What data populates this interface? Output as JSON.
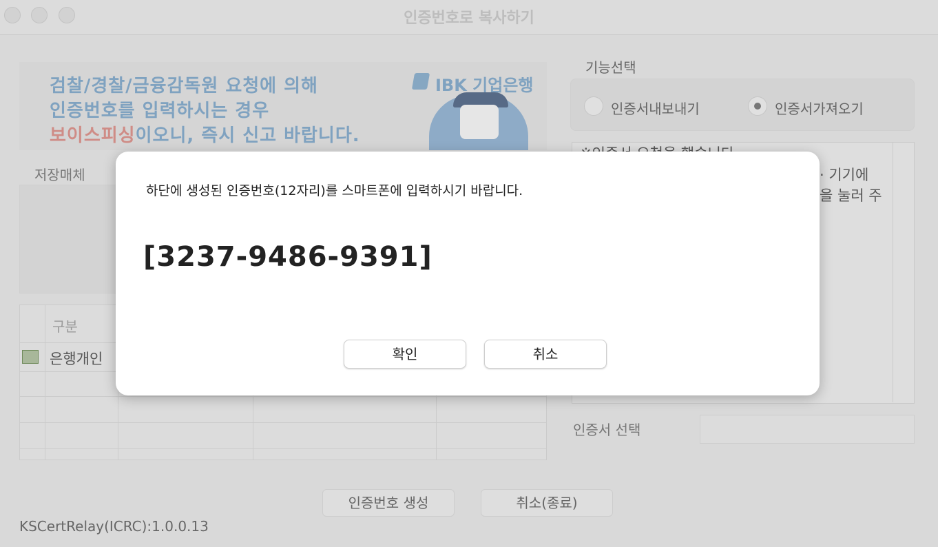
{
  "window": {
    "title": "인증번호로 복사하기"
  },
  "banner": {
    "line1": "검찰/경찰/금융감독원 요청에 의해",
    "line2": "인증번호를 입력하시는 경우",
    "line3_red": "보이스피싱",
    "line3_rest": "이오니, 즉시 신고 바랍니다.",
    "brand": "IBK 기업은행"
  },
  "left": {
    "storage_label": "저장매체",
    "table_header": "구분",
    "row1_label": "은행개인"
  },
  "right": {
    "function_label": "기능선택",
    "radio_export": "인증서내보내기",
    "radio_import": "인증서가져오기",
    "selected": "인증서가져오기",
    "notice_line1": "※인증서 요청을 했습니다",
    "notice_line2": "· 기기에",
    "notice_line3": "을 눌러 주",
    "cert_select_label": "인증서 선택"
  },
  "buttons": {
    "generate": "인증번호 생성",
    "cancel_exit": "취소(종료)"
  },
  "version": "KSCertRelay(ICRC):1.0.0.13",
  "modal": {
    "message": "하단에 생성된 인증번호(12자리)를 스마트폰에 입력하시기 바랍니다.",
    "code": "[3237-9486-9391]",
    "ok": "확인",
    "cancel": "취소"
  }
}
